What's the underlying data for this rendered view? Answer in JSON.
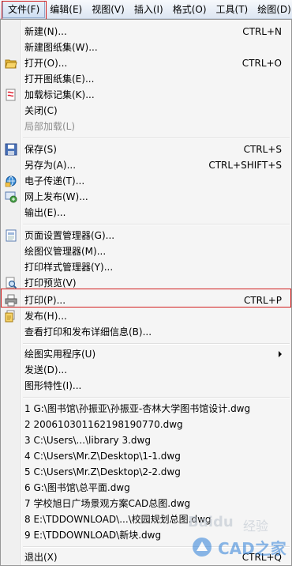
{
  "menubar": {
    "items": [
      {
        "label": "文件(F)"
      },
      {
        "label": "编辑(E)"
      },
      {
        "label": "视图(V)"
      },
      {
        "label": "插入(I)"
      },
      {
        "label": "格式(O)"
      },
      {
        "label": "工具(T)"
      },
      {
        "label": "绘图(D)"
      }
    ]
  },
  "file_menu": {
    "new": {
      "label": "新建(N)...",
      "shortcut": "CTRL+N"
    },
    "new_sheet_set": {
      "label": "新建图纸集(W)..."
    },
    "open": {
      "label": "打开(O)...",
      "shortcut": "CTRL+O"
    },
    "open_sheet_set": {
      "label": "打开图纸集(E)..."
    },
    "load_markup": {
      "label": "加载标记集(K)..."
    },
    "close": {
      "label": "关闭(C)"
    },
    "partial_load": {
      "label": "局部加载(L)"
    },
    "save": {
      "label": "保存(S)",
      "shortcut": "CTRL+S"
    },
    "save_as": {
      "label": "另存为(A)...",
      "shortcut": "CTRL+SHIFT+S"
    },
    "etransmit": {
      "label": "电子传递(T)..."
    },
    "publish_web": {
      "label": "网上发布(W)..."
    },
    "export": {
      "label": "输出(E)..."
    },
    "page_setup": {
      "label": "页面设置管理器(G)..."
    },
    "plotter_manager": {
      "label": "绘图仪管理器(M)..."
    },
    "plot_style_manager": {
      "label": "打印样式管理器(Y)..."
    },
    "plot_preview": {
      "label": "打印预览(V)"
    },
    "plot": {
      "label": "打印(P)...",
      "shortcut": "CTRL+P"
    },
    "publish": {
      "label": "发布(H)..."
    },
    "plot_details": {
      "label": "查看打印和发布详细信息(B)..."
    },
    "drawing_utilities": {
      "label": "绘图实用程序(U)"
    },
    "send": {
      "label": "发送(D)..."
    },
    "drawing_properties": {
      "label": "图形特性(I)..."
    },
    "recent": [
      "1 G:\\图书馆\\孙振亚\\孙振亚-杏林大学图书馆设计.dwg",
      "2 20061030116219819077​0.dwg",
      "3 C:\\Users\\...\\library 3.dwg",
      "4 C:\\Users\\Mr.Z\\Desktop\\1-1.dwg",
      "5 C:\\Users\\Mr.Z\\Desktop\\2-2.dwg",
      "6 G:\\图书馆\\总平面.dwg",
      "7 学校旭日广场景观方案CAD总图.dwg",
      "8 E:\\TDDOWNLOAD\\...\\校园规划总图.dwg",
      "9 E:\\TDDOWNLOAD\\新块.dwg"
    ],
    "exit": {
      "label": "退出(X)",
      "shortcut": "CTRL+Q"
    }
  },
  "watermark": {
    "baidu": "Baidu",
    "exp": "经验",
    "site": "CAD之家"
  }
}
